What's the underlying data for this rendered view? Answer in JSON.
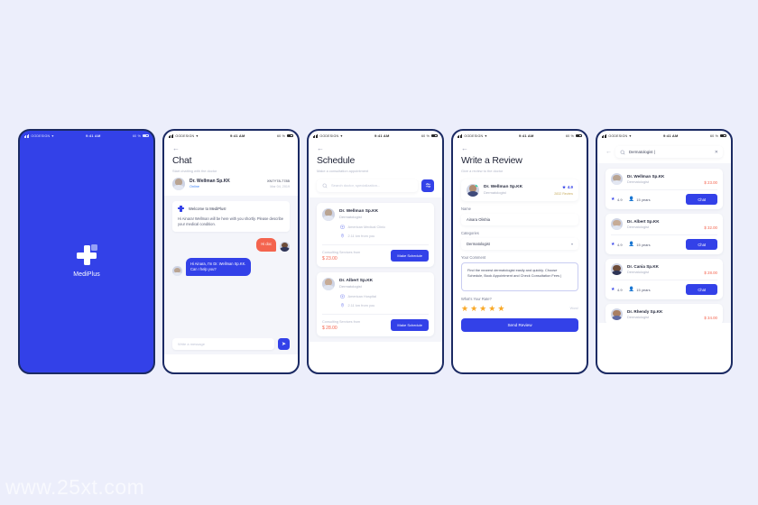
{
  "watermark": "www.25xt.com",
  "statusbar": {
    "carrier": "OODESIGN",
    "wifi_icon": "wifi-icon",
    "time": "9:41 AM",
    "battery": "60 %"
  },
  "splash": {
    "brand": "MediPlus",
    "logo_icon": "medical-cross-icon"
  },
  "chat": {
    "back_icon": "back-arrow-icon",
    "title": "Chat",
    "subtitle": "Start chatting with the doctor",
    "doctor": {
      "name": "Dr. Wellman Sp.KK",
      "status": "Online",
      "id": "XN7Y78-7785",
      "date": "Mar 04, 2019"
    },
    "system": {
      "icon": "medical-cross-icon",
      "title": "Welcome to MediPlus!",
      "text": "Hi Ainara! Wellman will be here with you shortly. Please describe your medical condition."
    },
    "messages": [
      {
        "from": "me",
        "text": "Hi doc"
      },
      {
        "from": "them",
        "text": "Hi Ainara, I'm Dr. Wellman Sp.KK. Can I help you?"
      }
    ],
    "input_placeholder": "Write a message",
    "send_icon": "send-icon"
  },
  "schedule": {
    "back_icon": "back-arrow-icon",
    "title": "Schedule",
    "subtitle": "Make a consultation appointment",
    "search_placeholder": "Search doctor, specialization...",
    "search_icon": "search-icon",
    "filter_icon": "filter-icon",
    "fee_label": "Consulting Services from",
    "button_label": "Make Schedule",
    "cards": [
      {
        "name": "Dr. Wellman Sp.KK",
        "specialty": "Dermatologist",
        "clinic": "American Medical Clinic",
        "clinic_icon": "hospital-icon",
        "distance": "2.11 km from you",
        "distance_icon": "location-pin-icon",
        "fee": "$ 23.00"
      },
      {
        "name": "Dr. Albert Sp.KK",
        "specialty": "Dermatologist",
        "clinic": "American Hospital",
        "clinic_icon": "hospital-icon",
        "distance": "2.11 km from you",
        "distance_icon": "location-pin-icon",
        "fee": "$ 28.00"
      }
    ]
  },
  "review": {
    "back_icon": "back-arrow-icon",
    "title": "Write a Review",
    "subtitle": "Give a review to the doctor",
    "doctor": {
      "name": "Dr. Wellman Sp.KK",
      "specialty": "Dermatologist",
      "rating": "4.9",
      "rating_icon": "star-icon",
      "reviews": "2832 Review"
    },
    "name_label": "Name",
    "name_value": "Ainara Olishia",
    "categories_label": "Categories",
    "categories_value": "Dermatologist",
    "categories_icon": "chevron-down-icon",
    "comment_label": "Your Comment",
    "comment_value": "Find the nearest dermatologist easily and quickly. Choose Schedule, Book Appointment and Check Consultation Fees |",
    "rate_label": "What's Your Rate?",
    "stars": 5,
    "star_glyph": "★",
    "rate_word": "Wow!",
    "submit_label": "Send Review"
  },
  "doctor_list": {
    "back_icon": "back-arrow-icon",
    "search_icon": "search-icon",
    "search_value": "Dermatologist |",
    "clear_icon": "close-icon",
    "chat_button": "Chat",
    "rating_icon": "star-icon",
    "experience_icon": "user-badge-icon",
    "items": [
      {
        "name": "Dr. Wellman Sp.KK",
        "specialty": "Dermatologist",
        "price": "$ 23.00",
        "rating": "4.9",
        "experience": "15 years"
      },
      {
        "name": "Dr. Albert Sp.KK",
        "specialty": "Dermatologist",
        "price": "$ 32.00",
        "rating": "4.9",
        "experience": "15 years"
      },
      {
        "name": "Dr. Cania Sp.KK",
        "specialty": "Dermatologist",
        "price": "$ 28.00",
        "rating": "4.9",
        "experience": "15 years"
      },
      {
        "name": "Dr. Rhendy Sp.KK",
        "specialty": "Dermatologist",
        "price": "$ 34.00",
        "rating": "4.9",
        "experience": "15 years"
      }
    ]
  },
  "colors": {
    "primary": "#3341e8",
    "accent": "#f4644e",
    "star": "#f9a826",
    "bg": "#eceefb"
  }
}
